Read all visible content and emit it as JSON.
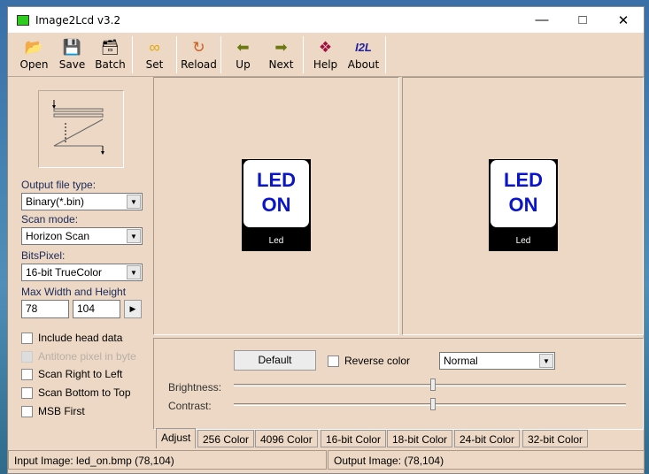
{
  "window": {
    "title": "Image2Lcd v3.2",
    "icon_text": "I2L"
  },
  "toolbar": [
    {
      "label": "Open",
      "icon": "open-icon"
    },
    {
      "label": "Save",
      "icon": "save-icon"
    },
    {
      "label": "Batch",
      "icon": "batch-icon"
    },
    {
      "label": "Set",
      "icon": "glasses-icon"
    },
    {
      "label": "Reload",
      "icon": "reload-icon"
    },
    {
      "label": "Up",
      "icon": "arrow-left-icon"
    },
    {
      "label": "Next",
      "icon": "arrow-right-icon"
    },
    {
      "label": "Help",
      "icon": "help-book-icon"
    },
    {
      "label": "About",
      "icon": "i2l-icon",
      "icon_text": "I2L"
    }
  ],
  "left": {
    "output_type_label": "Output file type:",
    "output_type": "Binary(*.bin)",
    "scan_mode_label": "Scan mode:",
    "scan_mode": "Horizon Scan",
    "bits_label": "BitsPixel:",
    "bits": "16-bit TrueColor",
    "size_label": "Max Width and Height",
    "width": "78",
    "height": "104",
    "checks": [
      {
        "label": "Include head data",
        "checked": false,
        "disabled": false
      },
      {
        "label": "Antitone pixel in byte",
        "checked": false,
        "disabled": true
      },
      {
        "label": "Scan Right to Left",
        "checked": false,
        "disabled": false
      },
      {
        "label": "Scan Bottom to Top",
        "checked": false,
        "disabled": false
      },
      {
        "label": "MSB First",
        "checked": false,
        "disabled": false
      }
    ]
  },
  "preview": {
    "input": {
      "line1": "LED",
      "line2": "ON",
      "caption": "Led"
    },
    "output": {
      "line1": "LED",
      "line2": "ON",
      "caption": "Led"
    }
  },
  "adjust": {
    "default_label": "Default",
    "reverse_label": "Reverse color",
    "mode": "Normal",
    "brightness_label": "Brightness:",
    "contrast_label": "Contrast:",
    "brightness": 0.5,
    "contrast": 0.5
  },
  "tabs": [
    "Adjust",
    "256 Color",
    "4096 Color",
    "16-bit Color",
    "18-bit Color",
    "24-bit Color",
    "32-bit Color"
  ],
  "status": {
    "input": "Input Image: led_on.bmp (78,104)",
    "output": "Output Image: (78,104)"
  }
}
